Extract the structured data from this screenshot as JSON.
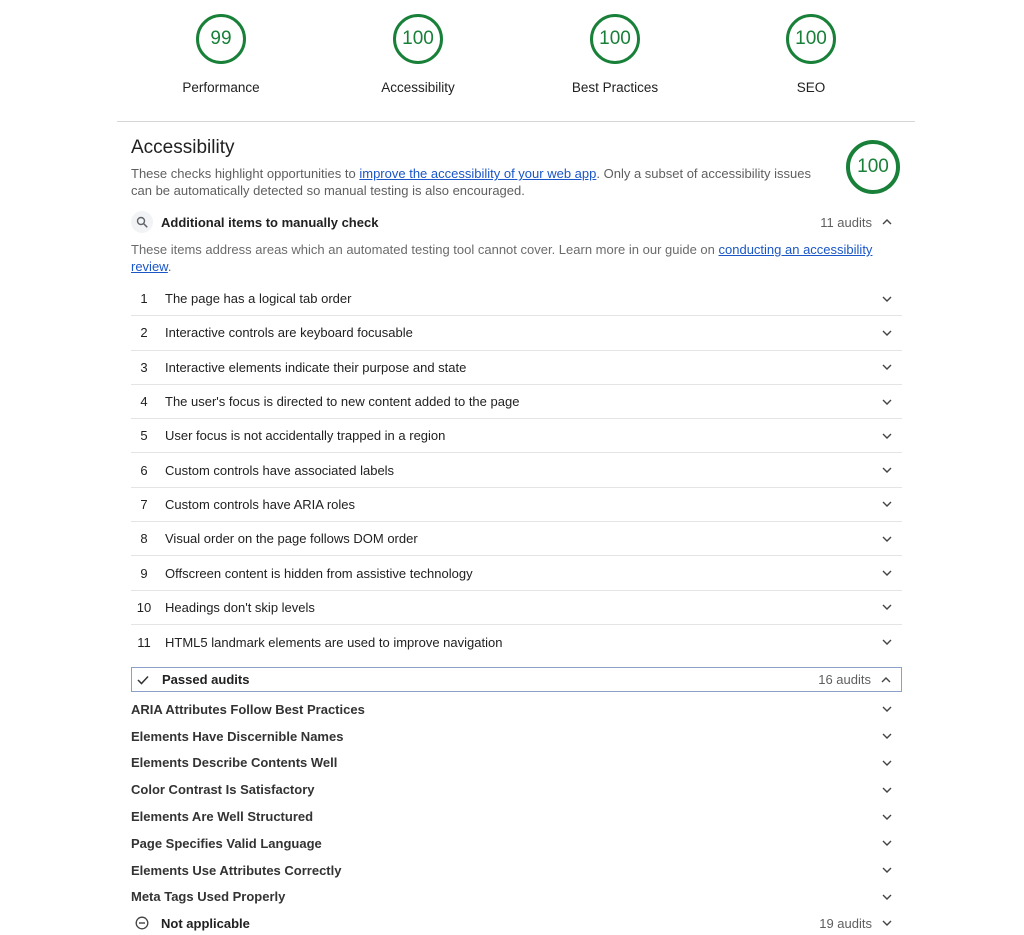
{
  "gauges": [
    {
      "score": "99",
      "label": "Performance"
    },
    {
      "score": "100",
      "label": "Accessibility"
    },
    {
      "score": "100",
      "label": "Best Practices"
    },
    {
      "score": "100",
      "label": "SEO"
    }
  ],
  "category": {
    "title": "Accessibility",
    "score": "100",
    "desc_pre": "These checks highlight opportunities to ",
    "desc_link": "improve the accessibility of your web app",
    "desc_post": ". Only a subset of accessibility issues can be automatically detected so manual testing is also encouraged."
  },
  "manual_group": {
    "title": "Additional items to manually check",
    "count": "11 audits",
    "desc_pre": "These items address areas which an automated testing tool cannot cover. Learn more in our guide on ",
    "desc_link": "conducting an accessibility review",
    "desc_post": ".",
    "items": [
      {
        "num": "1",
        "title": "The page has a logical tab order"
      },
      {
        "num": "2",
        "title": "Interactive controls are keyboard focusable"
      },
      {
        "num": "3",
        "title": "Interactive elements indicate their purpose and state"
      },
      {
        "num": "4",
        "title": "The user's focus is directed to new content added to the page"
      },
      {
        "num": "5",
        "title": "User focus is not accidentally trapped in a region"
      },
      {
        "num": "6",
        "title": "Custom controls have associated labels"
      },
      {
        "num": "7",
        "title": "Custom controls have ARIA roles"
      },
      {
        "num": "8",
        "title": "Visual order on the page follows DOM order"
      },
      {
        "num": "9",
        "title": "Offscreen content is hidden from assistive technology"
      },
      {
        "num": "10",
        "title": "Headings don't skip levels"
      },
      {
        "num": "11",
        "title": "HTML5 landmark elements are used to improve navigation"
      }
    ]
  },
  "passed_group": {
    "title": "Passed audits",
    "count": "16 audits",
    "items": [
      "ARIA Attributes Follow Best Practices",
      "Elements Have Discernible Names",
      "Elements Describe Contents Well",
      "Color Contrast Is Satisfactory",
      "Elements Are Well Structured",
      "Page Specifies Valid Language",
      "Elements Use Attributes Correctly",
      "Meta Tags Used Properly"
    ]
  },
  "na_group": {
    "title": "Not applicable",
    "count": "19 audits"
  },
  "colors": {
    "pass": "#188038",
    "link": "#1a56c7",
    "focus_border": "#8aa0c9"
  },
  "icons": {
    "manual": "search-icon",
    "passed": "check-icon",
    "na": "minus-circle-icon",
    "expand": "chevron-down-icon",
    "collapse": "chevron-up-icon"
  }
}
